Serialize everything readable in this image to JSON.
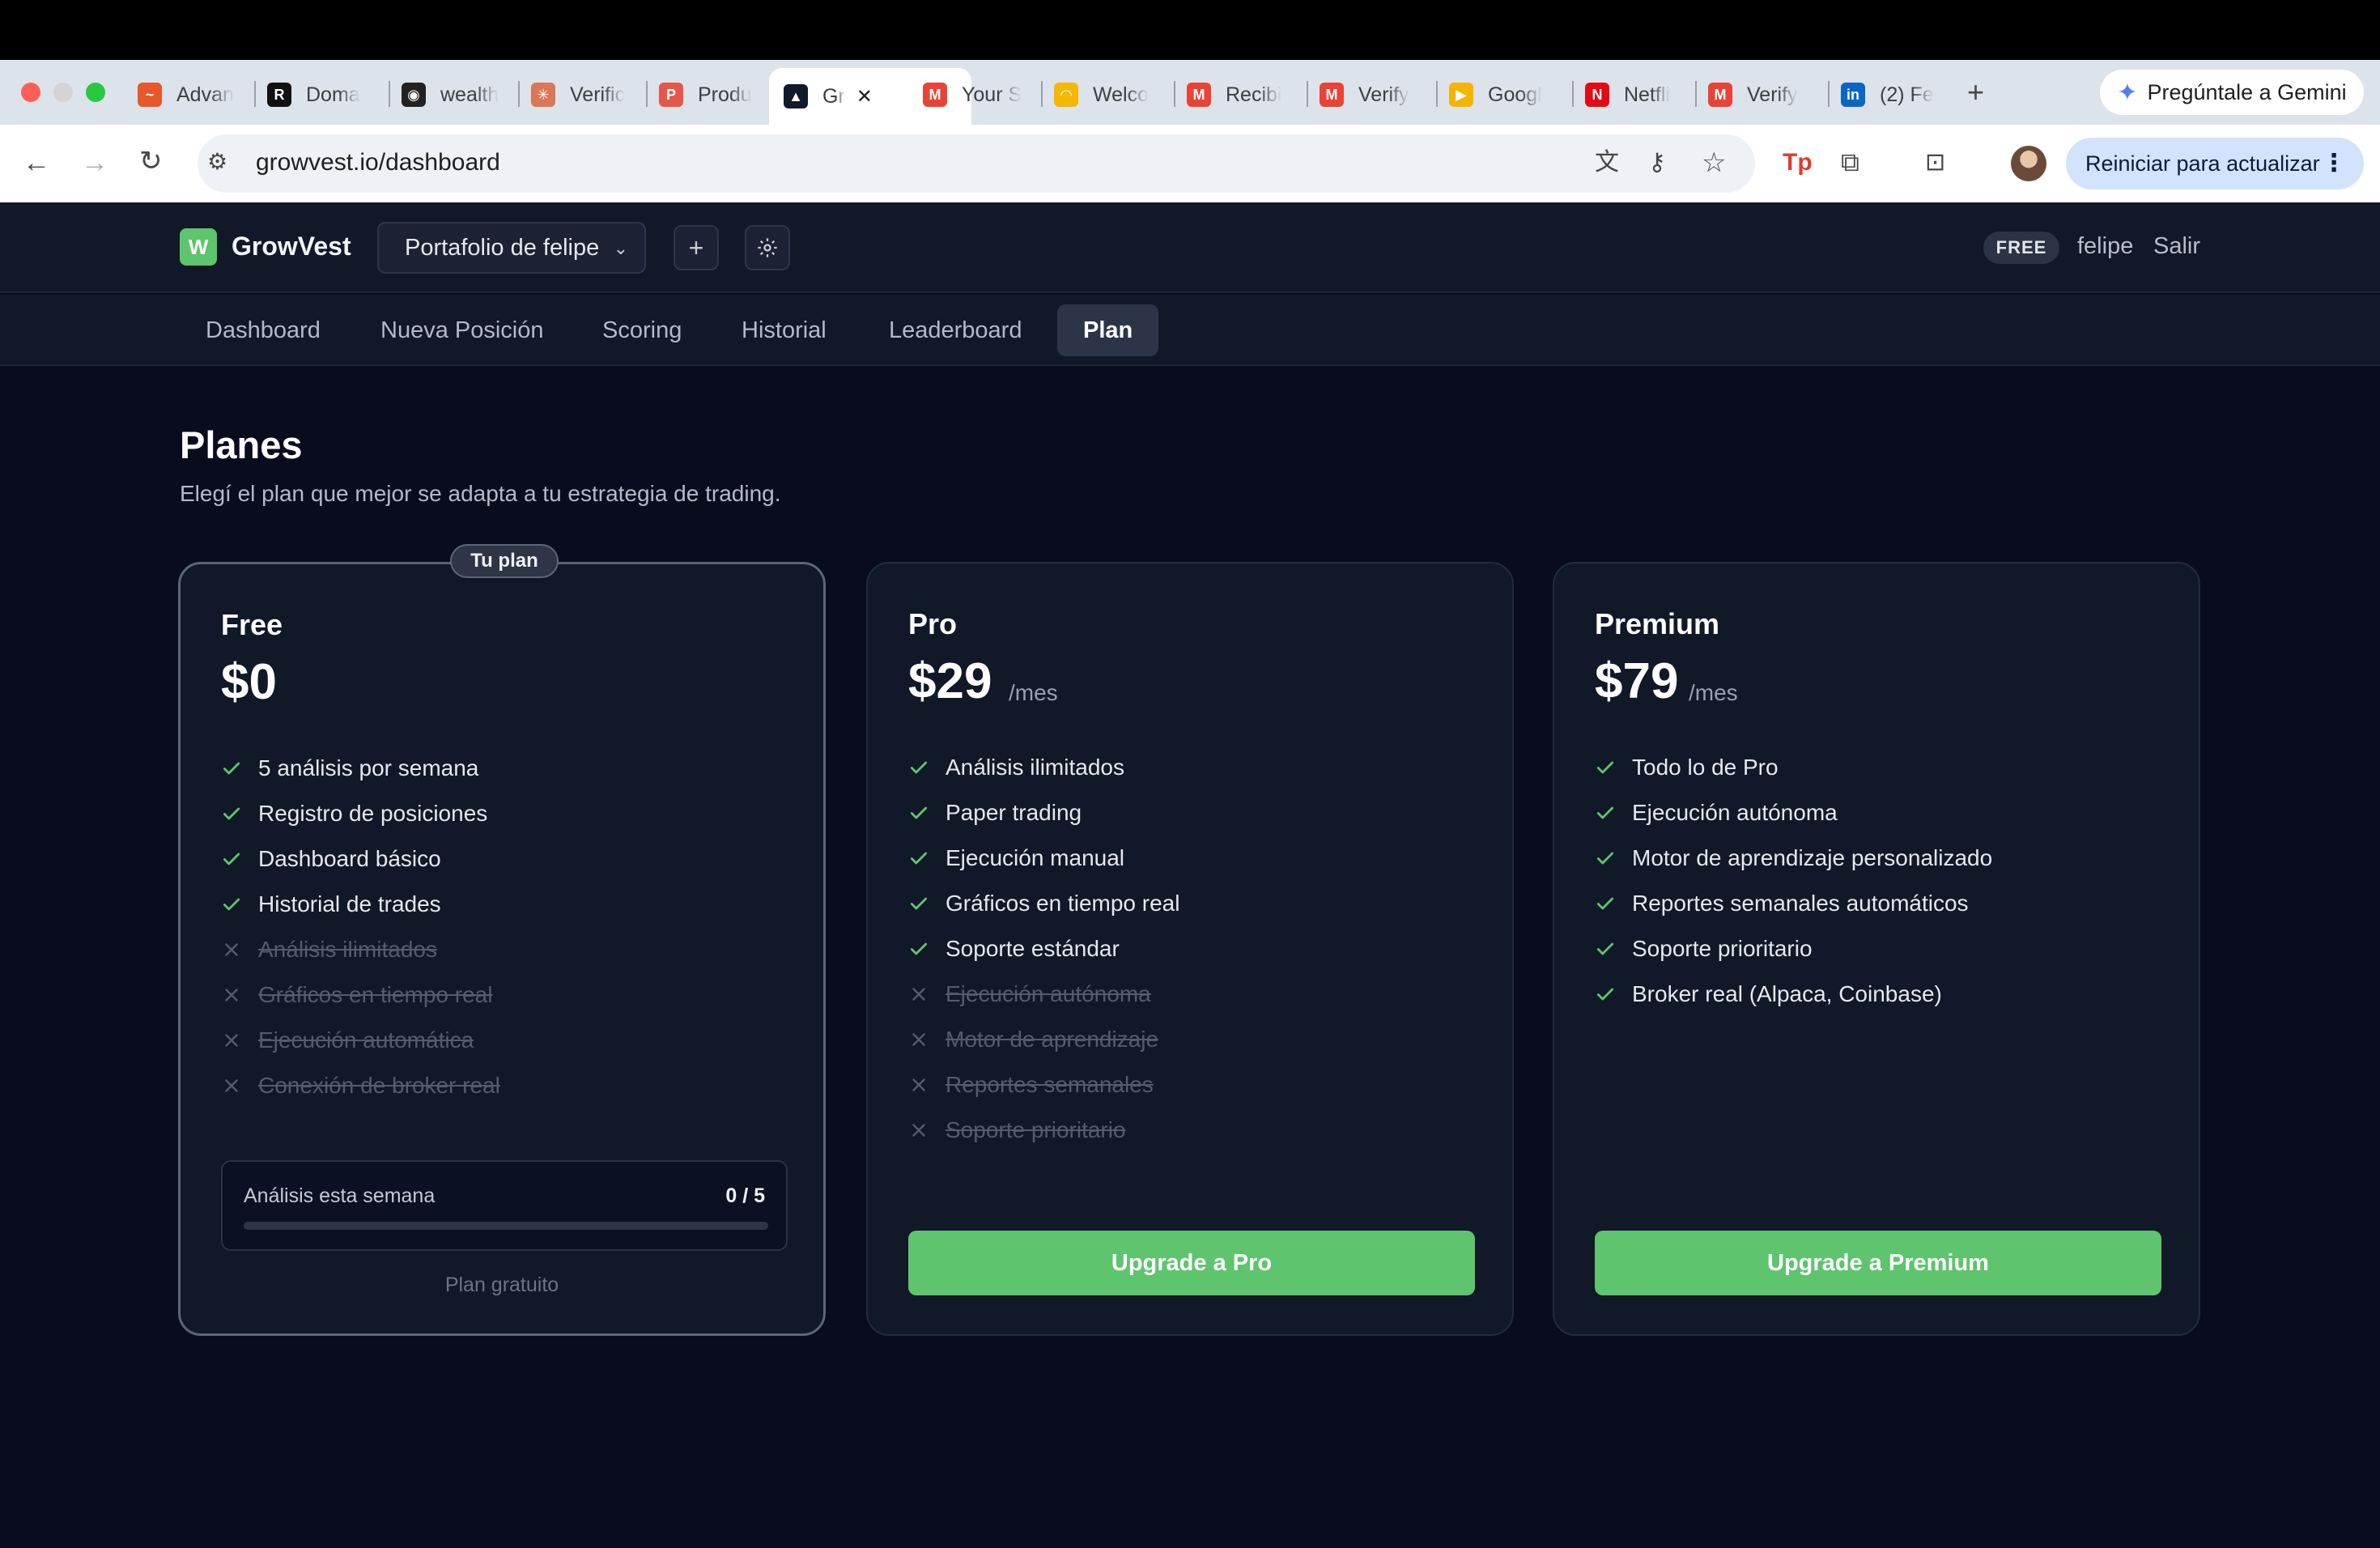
{
  "browser": {
    "tabs": [
      {
        "label": "Advan",
        "color": "#e8572a",
        "glyph": "~"
      },
      {
        "label": "Doma",
        "color": "#111111",
        "glyph": "R"
      },
      {
        "label": "wealth",
        "color": "#222222",
        "glyph": "◉"
      },
      {
        "label": "Verific",
        "color": "#d97757",
        "glyph": "✳"
      },
      {
        "label": "Produ",
        "color": "#e4574a",
        "glyph": "P"
      },
      {
        "label": "Gr",
        "color": "#0f1a2a",
        "glyph": "▲"
      },
      {
        "label": "Your S",
        "color": "#ea4335",
        "glyph": "M"
      },
      {
        "label": "Welco",
        "color": "#f5b800",
        "glyph": "◠"
      },
      {
        "label": "Recibi",
        "color": "#ea4335",
        "glyph": "M"
      },
      {
        "label": "Verify",
        "color": "#ea4335",
        "glyph": "M"
      },
      {
        "label": "Googl",
        "color": "#f4b400",
        "glyph": "▶"
      },
      {
        "label": "Netfli",
        "color": "#e50914",
        "glyph": "N"
      },
      {
        "label": "Verify",
        "color": "#ea4335",
        "glyph": "M"
      },
      {
        "label": "(2) Fe",
        "color": "#0a66c2",
        "glyph": "in"
      }
    ],
    "new_tab": "+",
    "gemini_label": "Pregúntale a Gemini",
    "url": "growvest.io/dashboard",
    "restart_label": "Reiniciar para actualizar"
  },
  "app": {
    "logo_letter": "W",
    "brand": "GrowVest",
    "portfolio": "Portafolio de felipe",
    "plan_badge": "FREE",
    "username": "felipe",
    "logout": "Salir",
    "nav": [
      "Dashboard",
      "Nueva Posición",
      "Scoring",
      "Historial",
      "Leaderboard",
      "Plan"
    ],
    "active_nav": "Plan"
  },
  "page": {
    "title": "Planes",
    "subtitle": "Elegí el plan que mejor se adapta a tu estrategia de trading."
  },
  "plans": {
    "free": {
      "badge": "Tu plan",
      "name": "Free",
      "price": "$0",
      "features_on": [
        "5 análisis por semana",
        "Registro de posiciones",
        "Dashboard básico",
        "Historial de trades"
      ],
      "features_off": [
        "Análisis ilimitados",
        "Gráficos en tiempo real",
        "Ejecución automática",
        "Conexión de broker real"
      ],
      "usage_label": "Análisis esta semana",
      "usage_count": "0 / 5",
      "usage_fraction": 0,
      "note": "Plan gratuito"
    },
    "pro": {
      "name": "Pro",
      "price": "$29",
      "period": "/mes",
      "features_on": [
        "Análisis ilimitados",
        "Paper trading",
        "Ejecución manual",
        "Gráficos en tiempo real",
        "Soporte estándar"
      ],
      "features_off": [
        "Ejecución autónoma",
        "Motor de aprendizaje",
        "Reportes semanales",
        "Soporte prioritario"
      ],
      "cta": "Upgrade a Pro"
    },
    "premium": {
      "name": "Premium",
      "price": "$79",
      "period": "/mes",
      "features_on": [
        "Todo lo de Pro",
        "Ejecución autónoma",
        "Motor de aprendizaje personalizado",
        "Reportes semanales automáticos",
        "Soporte prioritario",
        "Broker real (Alpaca, Coinbase)"
      ],
      "features_off": [],
      "cta": "Upgrade a Premium"
    }
  },
  "colors": {
    "accent": "#5ec46d",
    "background": "#080c1c",
    "card": "#111827"
  }
}
